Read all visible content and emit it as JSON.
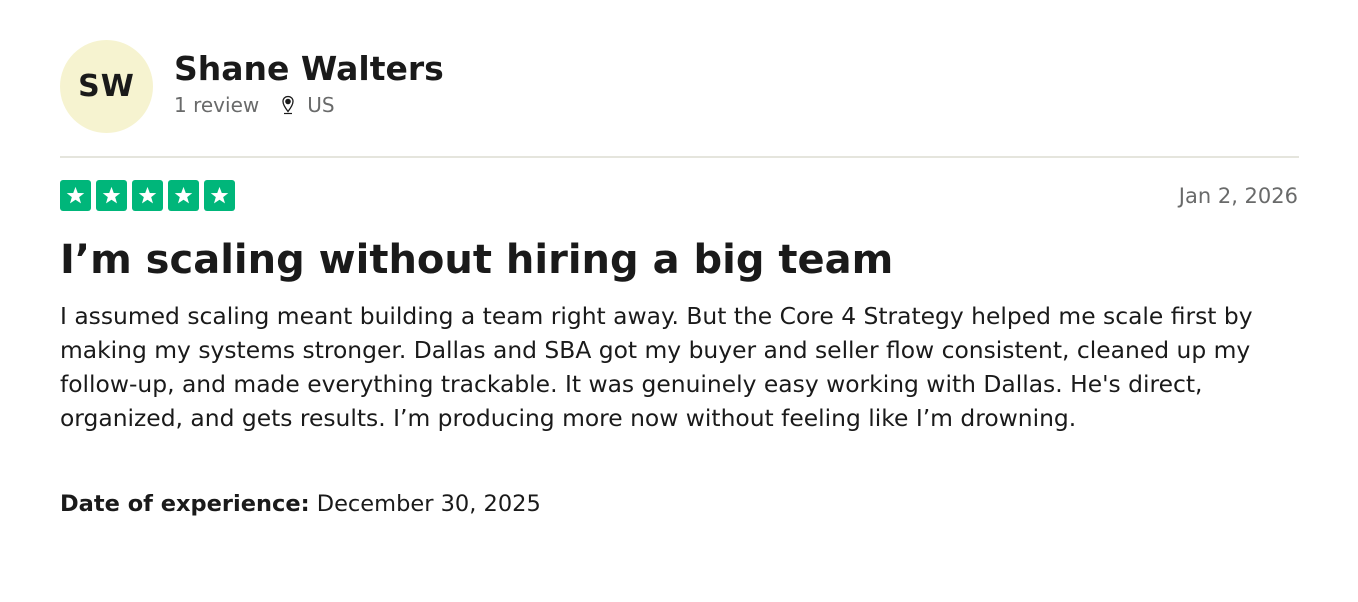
{
  "consumer": {
    "initials": "SW",
    "name": "Shane Walters",
    "review_count": "1 review",
    "country": "US",
    "location_icon": "map-pin-icon",
    "avatar_color": "#f6f3d0"
  },
  "review": {
    "rating": 5,
    "rating_max": 5,
    "star_color": "#00b67a",
    "star_icon": "star-icon",
    "date": "Jan 2, 2026",
    "title": "I’m scaling without hiring a big team",
    "text": "I assumed scaling meant building a team right away. But the Core 4 Strategy helped me scale first by making my systems stronger. Dallas and SBA got my buyer and seller flow consistent, cleaned up my follow-up, and made everything trackable. It was genuinely easy working with Dallas. He's direct, organized, and gets results. I’m producing more now without feeling like I’m drowning.",
    "experience_label": "Date of experience:",
    "experience_date": "December 30, 2025"
  }
}
